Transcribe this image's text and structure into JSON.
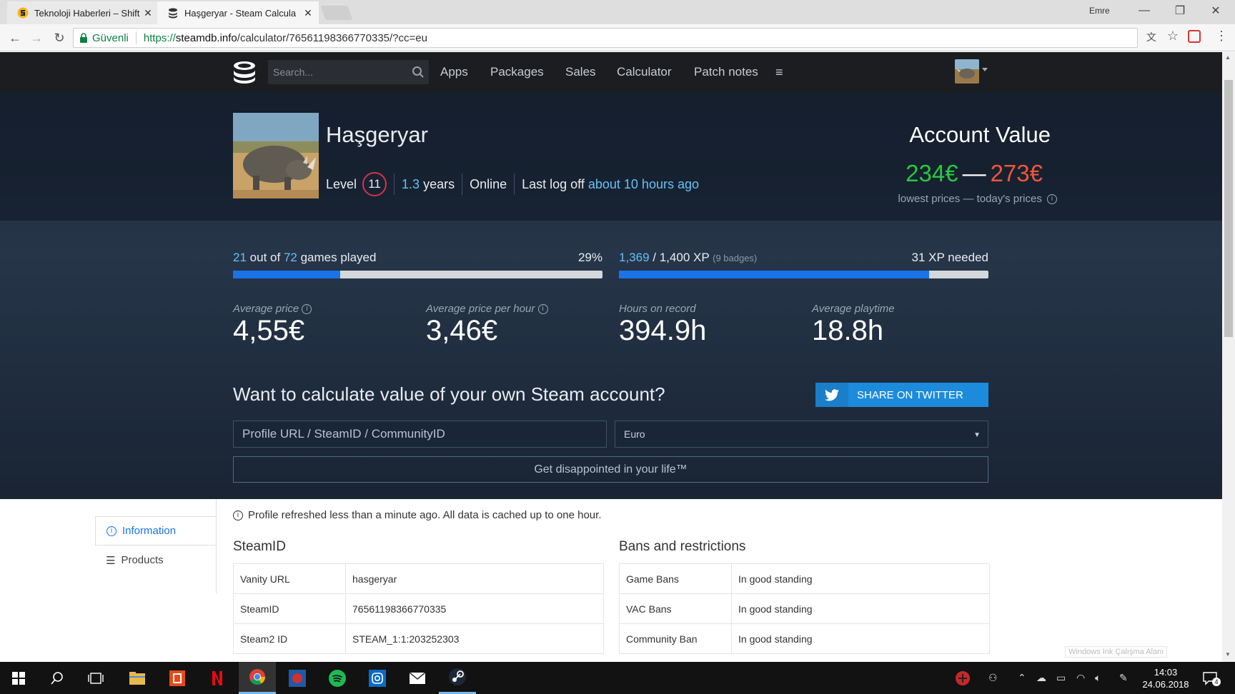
{
  "browser": {
    "tabs": [
      {
        "title": "Teknoloji Haberleri – Shift"
      },
      {
        "title": "Haşgeryar - Steam Calcula"
      }
    ],
    "window_user": "Emre",
    "secure_label": "Güvenli",
    "url_scheme": "https://",
    "url_host": "steamdb.info",
    "url_path": "/calculator/76561198366770335/?cc=eu"
  },
  "nav": {
    "search_placeholder": "Search...",
    "links": [
      "Apps",
      "Packages",
      "Sales",
      "Calculator",
      "Patch notes"
    ]
  },
  "profile": {
    "name": "Haşgeryar",
    "level_label": "Level",
    "level": "11",
    "years_value": "1.3",
    "years_unit": "years",
    "status": "Online",
    "last_logoff_label": "Last log off",
    "last_logoff_value": "about 10 hours ago"
  },
  "account_value": {
    "title": "Account Value",
    "low": "234€",
    "dash": "—",
    "high": "273€",
    "subtitle": "lowest prices — today's prices"
  },
  "progress": {
    "games_played": "21",
    "games_total": "72",
    "games_of": "out of",
    "games_suffix": "games played",
    "games_pct": "29%",
    "games_fraction": 0.29,
    "xp_current": "1,369",
    "xp_total": "/ 1,400 XP",
    "xp_badges": "(9 badges)",
    "xp_needed": "31 XP needed",
    "xp_fraction": 0.84
  },
  "stats": [
    {
      "label": "Average price",
      "value": "4,55€"
    },
    {
      "label": "Average price per hour",
      "value": "3,46€"
    },
    {
      "label": "Hours on record",
      "value": "394.9h"
    },
    {
      "label": "Average playtime",
      "value": "18.8h"
    }
  ],
  "cta": {
    "question": "Want to calculate value of your own Steam account?",
    "twitter_label": "SHARE ON TWITTER",
    "input_placeholder": "Profile URL / SteamID / CommunityID",
    "currency": "Euro",
    "submit": "Get disappointed in your life™"
  },
  "sidebar": {
    "items": [
      {
        "label": "Information"
      },
      {
        "label": "Products"
      }
    ]
  },
  "refresh_note": "Profile refreshed less than a minute ago. All data is cached up to one hour.",
  "steamid": {
    "title": "SteamID",
    "rows": [
      {
        "key": "Vanity URL",
        "value": "hasgeryar"
      },
      {
        "key": "SteamID",
        "value": "76561198366770335"
      },
      {
        "key": "Steam2 ID",
        "value": "STEAM_1:1:203252303"
      }
    ]
  },
  "bans": {
    "title": "Bans and restrictions",
    "rows": [
      {
        "key": "Game Bans",
        "value": "In good standing"
      },
      {
        "key": "VAC Bans",
        "value": "In good standing"
      },
      {
        "key": "Community Ban",
        "value": "In good standing"
      }
    ]
  },
  "taskbar": {
    "time": "14:03",
    "date": "24.06.2018",
    "notifications": "4",
    "ink_watermark": "Windows Ink Çalışma Alanı"
  },
  "colors": {
    "accent_blue": "#1a73e8",
    "steam_blue": "#66c0f4",
    "value_green": "#27c93f",
    "value_red": "#f0553a",
    "level_ring": "#d4334a",
    "twitter": "#1d8bdc"
  }
}
